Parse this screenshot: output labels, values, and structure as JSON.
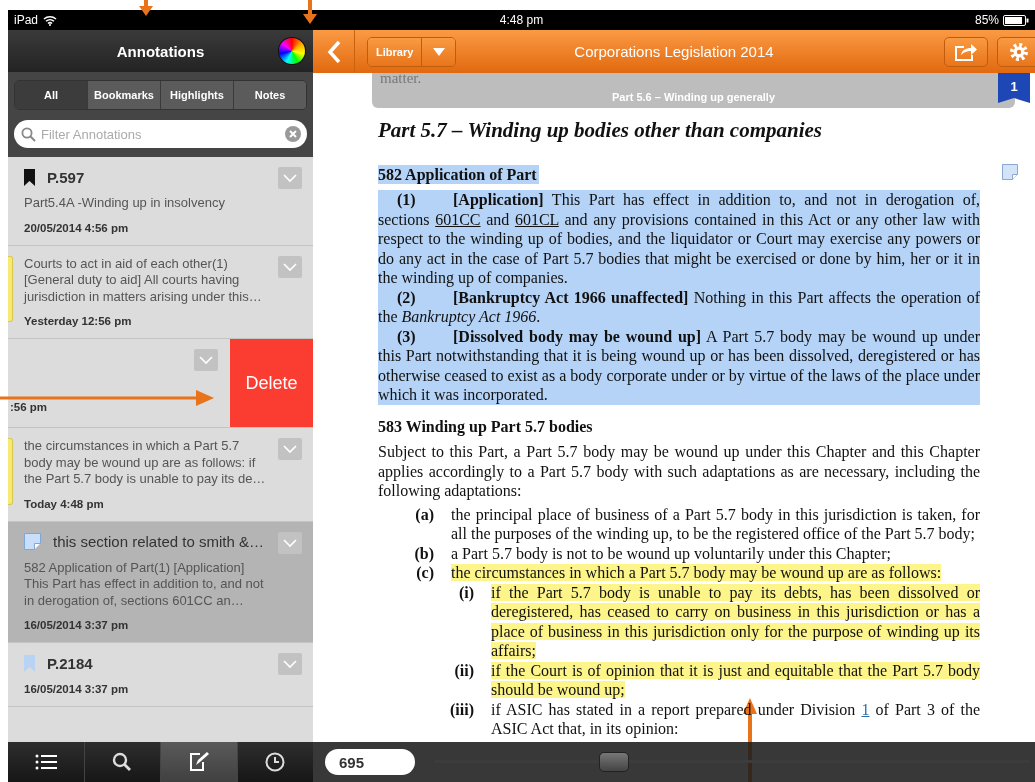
{
  "status_bar": {
    "device": "iPad",
    "time": "4:48 pm",
    "battery": "85%"
  },
  "annotations_panel": {
    "title": "Annotations",
    "tabs": [
      {
        "label": "All",
        "selected": true
      },
      {
        "label": "Bookmarks",
        "selected": false
      },
      {
        "label": "Highlights",
        "selected": false
      },
      {
        "label": "Notes",
        "selected": false
      }
    ],
    "search": {
      "placeholder": "Filter Annotations"
    },
    "items": [
      {
        "kind": "bookmark",
        "color": "#111111",
        "title": "P.597",
        "text": "Part5.4A -Winding up in insolvency",
        "time": "20/05/2014 4:56 pm",
        "selected": false,
        "swiped": false
      },
      {
        "kind": "highlight",
        "text": "Courts to act in aid of each other(1) [General duty to aid] All courts having jurisdiction in matters arising under this…",
        "time": "Yesterday 12:56 pm",
        "selected": false,
        "swiped": false
      },
      {
        "time": ":56 pm",
        "action": "Delete",
        "selected": false,
        "swiped": true
      },
      {
        "kind": "highlight",
        "text": "the circumstances in which a Part 5.7 body may be wound up are as follows: if the Part 5.7 body is unable to pay its de…",
        "time": "Today 4:48 pm",
        "selected": false,
        "swiped": false
      },
      {
        "kind": "note",
        "title": "this section related to smith &…",
        "text": "582 Application of Part(1) [Application] This Part has effect in addition to, and not in derogation of, sections 601CC an…",
        "time": "16/05/2014 3:37 pm",
        "selected": true,
        "swiped": false
      },
      {
        "kind": "bookmark",
        "color": "#b9d4f3",
        "title": "P.2184",
        "time": "16/05/2014 3:37 pm",
        "selected": false,
        "swiped": false
      }
    ],
    "bottom_tabs": [
      {
        "kind": "list",
        "selected": false
      },
      {
        "kind": "search",
        "selected": false
      },
      {
        "kind": "annotate",
        "selected": true
      },
      {
        "kind": "history",
        "selected": false
      }
    ]
  },
  "toolbar": {
    "library": "Library",
    "title": "Corporations Legislation 2014"
  },
  "document": {
    "banner": {
      "cut_text": "matter.",
      "title": "Part 5.6 – Winding up generally"
    },
    "page_marker": "1",
    "note": true,
    "title": "Part 5.7 – Winding up bodies other than companies",
    "sections": [
      {
        "heading": "582 Application of Part",
        "highlighted": true,
        "blocks": [
          {
            "kind": "clause",
            "number": "(1)",
            "highlighted": true,
            "parts": [
              {
                "kind": "text",
                "text": "**[Application]** This Part has effect in addition to, and not in derogation of, sections "
              },
              {
                "kind": "link",
                "text": "601CC"
              },
              {
                "kind": "text",
                "text": " and "
              },
              {
                "kind": "link",
                "text": "601CL"
              },
              {
                "kind": "text",
                "text": " and any provisions contained in this Act or any other law with respect to the winding up of bodies, and the liquidator or Court may exercise any powers or do any act in the case of Part 5.7 bodies that might be exercised or done by him, her or it in the winding up of companies."
              }
            ]
          },
          {
            "kind": "clause",
            "number": "(2)",
            "highlighted": true,
            "parts": [
              {
                "kind": "text",
                "text": "**[Bankruptcy Act 1966 unaffected]** Nothing in this Part affects the operation of the *Bankruptcy Act 1966*."
              }
            ]
          },
          {
            "kind": "clause",
            "number": "(3)",
            "highlighted": true,
            "parts": [
              {
                "kind": "text",
                "text": "**[Dissolved body may be wound up]** A Part 5.7 body may be wound up under this Part notwithstanding that it is being wound up or has been dissolved, deregistered or has otherwise ceased to exist as a body corporate under or by virtue of the laws of the place under which it was incorporated."
              }
            ]
          }
        ]
      },
      {
        "heading": "583 Winding up Part 5.7 bodies",
        "highlighted": false,
        "blocks": [
          {
            "kind": "paragraph",
            "highlighted": false,
            "parts": [
              {
                "kind": "text",
                "text": "Subject to this Part, a Part 5.7 body may be wound up under this Chapter and this Chapter applies accordingly to a Part 5.7 body with such adaptations as are necessary, including the following adaptations:"
              }
            ]
          },
          {
            "kind": "item",
            "number": "(a)",
            "highlighted": false,
            "parts": [
              {
                "kind": "text",
                "text": "the principal place of business of a Part 5.7 body in this jurisdiction is taken, for all the purposes of the winding up, to be the registered office of the Part 5.7 body;"
              }
            ]
          },
          {
            "kind": "item",
            "number": "(b)",
            "highlighted": false,
            "parts": [
              {
                "kind": "text",
                "text": "a Part 5.7 body is not to be wound up voluntarily under this Chapter;"
              }
            ]
          },
          {
            "kind": "item",
            "number": "(c)",
            "highlighted": true,
            "parts": [
              {
                "kind": "text",
                "text": "the circumstances in which a Part 5.7 body may be wound up are as follows:"
              }
            ],
            "children": [
              {
                "kind": "item",
                "number": "(i)",
                "highlighted": true,
                "parts": [
                  {
                    "kind": "text",
                    "text": "if the Part 5.7 body is unable to pay its debts, has been dissolved or deregistered, has ceased to carry on business in this jurisdiction or has a place of business in this jurisdiction only for the purpose of winding up its affairs;"
                  }
                ]
              },
              {
                "kind": "item",
                "number": "(ii)",
                "highlighted": true,
                "parts": [
                  {
                    "kind": "text",
                    "text": "if the Court is of opinion that it is just and equitable that the Part 5.7 body should be wound up;"
                  }
                ]
              },
              {
                "kind": "item",
                "number": "(iii)",
                "highlighted": false,
                "parts": [
                  {
                    "kind": "text",
                    "text": "if ASIC has stated in a report prepared under Division "
                  },
                  {
                    "kind": "link",
                    "text": "1"
                  },
                  {
                    "kind": "text",
                    "text": " of Part 3 of the ASIC Act that, in its opinion:"
                  }
                ]
              }
            ]
          }
        ]
      }
    ]
  },
  "page_bar": {
    "page": "695",
    "slider": {
      "level": 0.29
    }
  }
}
